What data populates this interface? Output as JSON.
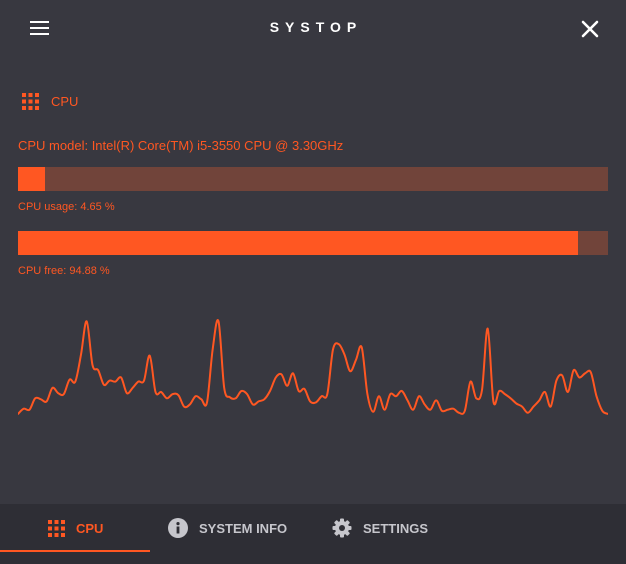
{
  "header": {
    "title": "SYSTOP",
    "menu_icon": "hamburger-menu-icon",
    "close_icon": "close-icon"
  },
  "section": {
    "icon": "grid-apps-icon",
    "title": "CPU"
  },
  "cpu": {
    "model_text": "CPU model: Intel(R) Core(TM) i5-3550 CPU @ 3.30GHz",
    "usage_label": "CPU usage: 4.65 %",
    "usage_percent": 4.65,
    "free_label": "CPU free: 94.88 %",
    "free_percent": 94.88
  },
  "history": {
    "values": [
      3,
      8,
      7,
      18,
      17,
      15,
      28,
      23,
      22,
      36,
      34,
      60,
      92,
      50,
      45,
      31,
      35,
      34,
      38,
      23,
      28,
      34,
      35,
      59,
      24,
      24,
      18,
      22,
      21,
      10,
      12,
      20,
      17,
      14,
      66,
      92,
      28,
      19,
      18,
      25,
      22,
      12,
      15,
      17,
      25,
      38,
      41,
      30,
      42,
      25,
      27,
      15,
      14,
      20,
      22,
      65,
      70,
      60,
      44,
      55,
      67,
      22,
      5,
      20,
      7,
      22,
      20,
      25,
      16,
      7,
      20,
      12,
      7,
      16,
      6,
      7,
      8,
      4,
      6,
      34,
      18,
      26,
      85,
      15,
      25,
      22,
      18,
      13,
      10,
      4,
      10,
      16,
      24,
      10,
      35,
      40,
      24,
      45,
      38,
      42,
      43,
      20,
      6,
      3
    ],
    "y_max": 100
  },
  "nav": {
    "tabs": [
      {
        "label": "CPU",
        "icon": "grid-apps-icon",
        "active": true
      },
      {
        "label": "SYSTEM INFO",
        "icon": "info-icon",
        "active": false
      },
      {
        "label": "SETTINGS",
        "icon": "gear-icon",
        "active": false
      }
    ]
  },
  "colors": {
    "accent": "#ff5722",
    "bar_track": "#71443a",
    "background": "#383840",
    "nav_background": "#2e2e35",
    "inactive_text": "#c6c6cc"
  }
}
